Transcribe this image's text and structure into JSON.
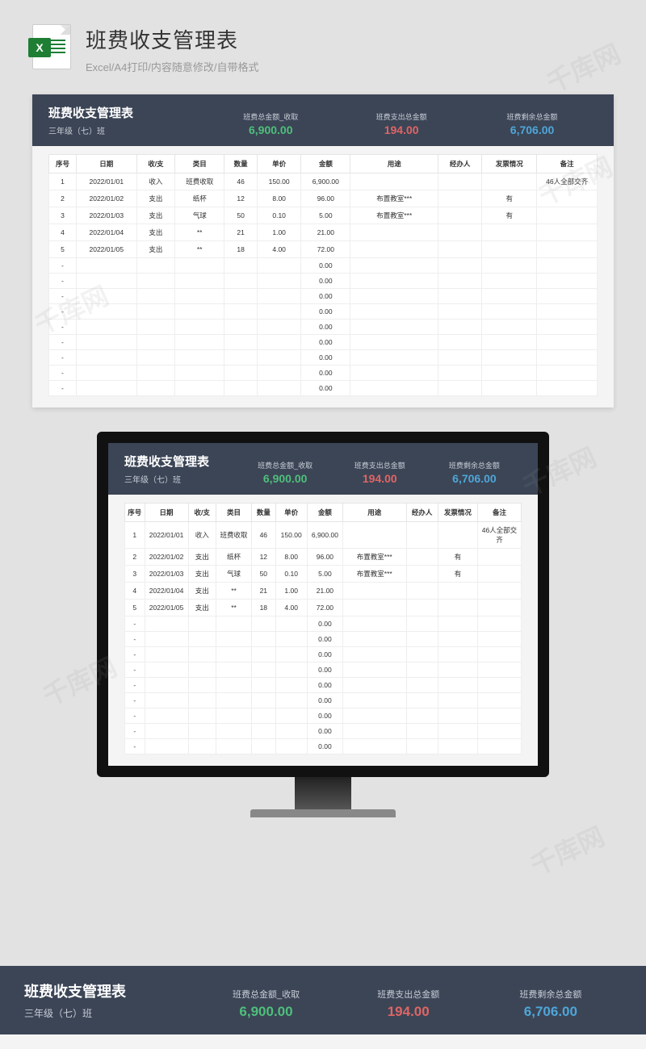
{
  "page": {
    "title": "班费收支管理表",
    "subtitle": "Excel/A4打印/内容随意修改/自带格式",
    "excel_icon_letter": "X"
  },
  "sheet": {
    "title": "班费收支管理表",
    "subtitle": "三年级（七）班",
    "stats": [
      {
        "label": "班费总金额_收取",
        "value": "6,900.00",
        "cls": "c-green"
      },
      {
        "label": "班费支出总金额",
        "value": "194.00",
        "cls": "c-red"
      },
      {
        "label": "班费剩余总金额",
        "value": "6,706.00",
        "cls": "c-blue"
      }
    ],
    "columns": [
      "序号",
      "日期",
      "收/支",
      "类目",
      "数量",
      "单价",
      "金额",
      "用途",
      "经办人",
      "发票情况",
      "备注"
    ],
    "rows": [
      {
        "seq": "1",
        "date": "2022/01/01",
        "io": "收入",
        "item": "班费收取",
        "qty": "46",
        "price": "150.00",
        "amt": "6,900.00",
        "use": "",
        "handler": "",
        "invoice": "",
        "note": "46人全部交齐"
      },
      {
        "seq": "2",
        "date": "2022/01/02",
        "io": "支出",
        "item": "纸杯",
        "qty": "12",
        "price": "8.00",
        "amt": "96.00",
        "use": "布置教室***",
        "handler": "",
        "invoice": "有",
        "note": ""
      },
      {
        "seq": "3",
        "date": "2022/01/03",
        "io": "支出",
        "item": "气球",
        "qty": "50",
        "price": "0.10",
        "amt": "5.00",
        "use": "布置教室***",
        "handler": "",
        "invoice": "有",
        "note": ""
      },
      {
        "seq": "4",
        "date": "2022/01/04",
        "io": "支出",
        "item": "**",
        "qty": "21",
        "price": "1.00",
        "amt": "21.00",
        "use": "",
        "handler": "",
        "invoice": "",
        "note": ""
      },
      {
        "seq": "5",
        "date": "2022/01/05",
        "io": "支出",
        "item": "**",
        "qty": "18",
        "price": "4.00",
        "amt": "72.00",
        "use": "",
        "handler": "",
        "invoice": "",
        "note": ""
      },
      {
        "seq": "-",
        "date": "",
        "io": "",
        "item": "",
        "qty": "",
        "price": "",
        "amt": "0.00",
        "use": "",
        "handler": "",
        "invoice": "",
        "note": ""
      },
      {
        "seq": "-",
        "date": "",
        "io": "",
        "item": "",
        "qty": "",
        "price": "",
        "amt": "0.00",
        "use": "",
        "handler": "",
        "invoice": "",
        "note": ""
      },
      {
        "seq": "-",
        "date": "",
        "io": "",
        "item": "",
        "qty": "",
        "price": "",
        "amt": "0.00",
        "use": "",
        "handler": "",
        "invoice": "",
        "note": ""
      },
      {
        "seq": "-",
        "date": "",
        "io": "",
        "item": "",
        "qty": "",
        "price": "",
        "amt": "0.00",
        "use": "",
        "handler": "",
        "invoice": "",
        "note": ""
      },
      {
        "seq": "-",
        "date": "",
        "io": "",
        "item": "",
        "qty": "",
        "price": "",
        "amt": "0.00",
        "use": "",
        "handler": "",
        "invoice": "",
        "note": ""
      },
      {
        "seq": "-",
        "date": "",
        "io": "",
        "item": "",
        "qty": "",
        "price": "",
        "amt": "0.00",
        "use": "",
        "handler": "",
        "invoice": "",
        "note": ""
      },
      {
        "seq": "-",
        "date": "",
        "io": "",
        "item": "",
        "qty": "",
        "price": "",
        "amt": "0.00",
        "use": "",
        "handler": "",
        "invoice": "",
        "note": ""
      },
      {
        "seq": "-",
        "date": "",
        "io": "",
        "item": "",
        "qty": "",
        "price": "",
        "amt": "0.00",
        "use": "",
        "handler": "",
        "invoice": "",
        "note": ""
      },
      {
        "seq": "-",
        "date": "",
        "io": "",
        "item": "",
        "qty": "",
        "price": "",
        "amt": "0.00",
        "use": "",
        "handler": "",
        "invoice": "",
        "note": ""
      }
    ]
  },
  "watermark": "千库网"
}
